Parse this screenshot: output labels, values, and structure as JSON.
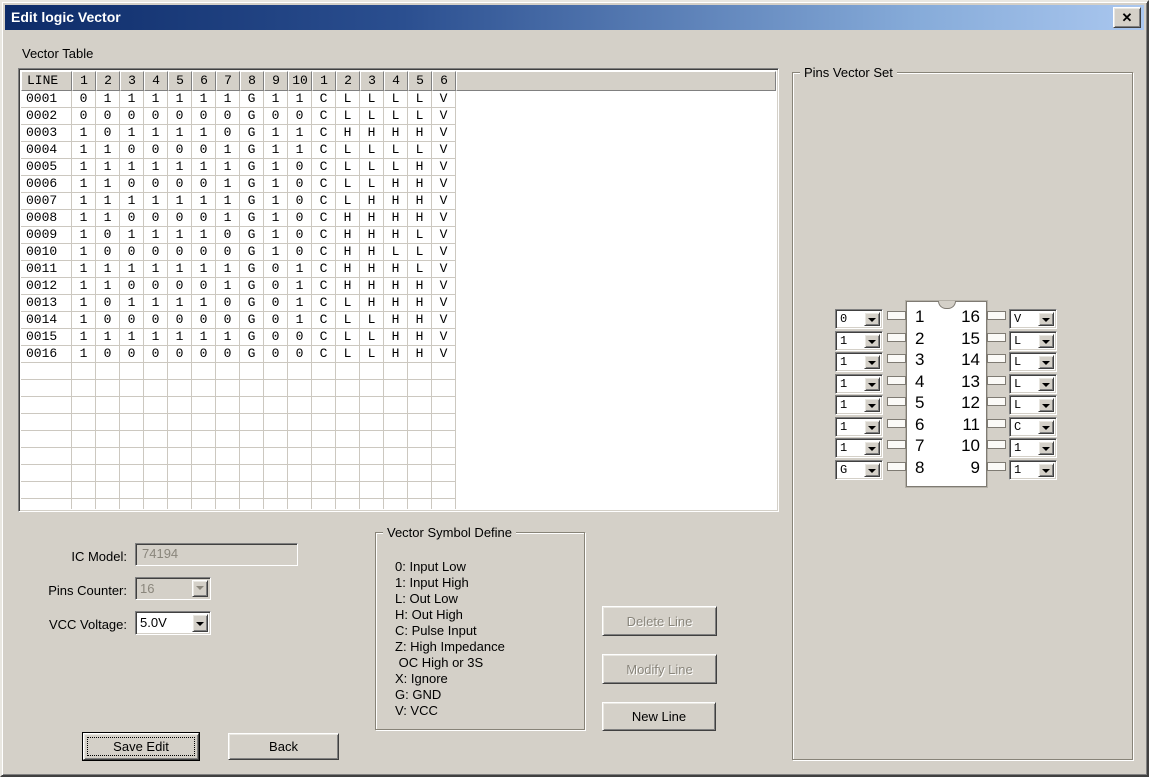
{
  "window": {
    "title": "Edit logic Vector",
    "close_icon": "✕"
  },
  "vector_table": {
    "label": "Vector Table",
    "line_header": "LINE",
    "columns": [
      "1",
      "2",
      "3",
      "4",
      "5",
      "6",
      "7",
      "8",
      "9",
      "10",
      "1",
      "2",
      "3",
      "4",
      "5",
      "6"
    ],
    "rows": [
      {
        "line": "0001",
        "cells": [
          "0",
          "1",
          "1",
          "1",
          "1",
          "1",
          "1",
          "G",
          "1",
          "1",
          "C",
          "L",
          "L",
          "L",
          "L",
          "V"
        ]
      },
      {
        "line": "0002",
        "cells": [
          "0",
          "0",
          "0",
          "0",
          "0",
          "0",
          "0",
          "G",
          "0",
          "0",
          "C",
          "L",
          "L",
          "L",
          "L",
          "V"
        ]
      },
      {
        "line": "0003",
        "cells": [
          "1",
          "0",
          "1",
          "1",
          "1",
          "1",
          "0",
          "G",
          "1",
          "1",
          "C",
          "H",
          "H",
          "H",
          "H",
          "V"
        ]
      },
      {
        "line": "0004",
        "cells": [
          "1",
          "1",
          "0",
          "0",
          "0",
          "0",
          "1",
          "G",
          "1",
          "1",
          "C",
          "L",
          "L",
          "L",
          "L",
          "V"
        ]
      },
      {
        "line": "0005",
        "cells": [
          "1",
          "1",
          "1",
          "1",
          "1",
          "1",
          "1",
          "G",
          "1",
          "0",
          "C",
          "L",
          "L",
          "L",
          "H",
          "V"
        ]
      },
      {
        "line": "0006",
        "cells": [
          "1",
          "1",
          "0",
          "0",
          "0",
          "0",
          "1",
          "G",
          "1",
          "0",
          "C",
          "L",
          "L",
          "H",
          "H",
          "V"
        ]
      },
      {
        "line": "0007",
        "cells": [
          "1",
          "1",
          "1",
          "1",
          "1",
          "1",
          "1",
          "G",
          "1",
          "0",
          "C",
          "L",
          "H",
          "H",
          "H",
          "V"
        ]
      },
      {
        "line": "0008",
        "cells": [
          "1",
          "1",
          "0",
          "0",
          "0",
          "0",
          "1",
          "G",
          "1",
          "0",
          "C",
          "H",
          "H",
          "H",
          "H",
          "V"
        ]
      },
      {
        "line": "0009",
        "cells": [
          "1",
          "0",
          "1",
          "1",
          "1",
          "1",
          "0",
          "G",
          "1",
          "0",
          "C",
          "H",
          "H",
          "H",
          "L",
          "V"
        ]
      },
      {
        "line": "0010",
        "cells": [
          "1",
          "0",
          "0",
          "0",
          "0",
          "0",
          "0",
          "G",
          "1",
          "0",
          "C",
          "H",
          "H",
          "L",
          "L",
          "V"
        ]
      },
      {
        "line": "0011",
        "cells": [
          "1",
          "1",
          "1",
          "1",
          "1",
          "1",
          "1",
          "G",
          "0",
          "1",
          "C",
          "H",
          "H",
          "H",
          "L",
          "V"
        ]
      },
      {
        "line": "0012",
        "cells": [
          "1",
          "1",
          "0",
          "0",
          "0",
          "0",
          "1",
          "G",
          "0",
          "1",
          "C",
          "H",
          "H",
          "H",
          "H",
          "V"
        ]
      },
      {
        "line": "0013",
        "cells": [
          "1",
          "0",
          "1",
          "1",
          "1",
          "1",
          "0",
          "G",
          "0",
          "1",
          "C",
          "L",
          "H",
          "H",
          "H",
          "V"
        ]
      },
      {
        "line": "0014",
        "cells": [
          "1",
          "0",
          "0",
          "0",
          "0",
          "0",
          "0",
          "G",
          "0",
          "1",
          "C",
          "L",
          "L",
          "H",
          "H",
          "V"
        ]
      },
      {
        "line": "0015",
        "cells": [
          "1",
          "1",
          "1",
          "1",
          "1",
          "1",
          "1",
          "G",
          "0",
          "0",
          "C",
          "L",
          "L",
          "H",
          "H",
          "V"
        ]
      },
      {
        "line": "0016",
        "cells": [
          "1",
          "0",
          "0",
          "0",
          "0",
          "0",
          "0",
          "G",
          "0",
          "0",
          "C",
          "L",
          "L",
          "H",
          "H",
          "V"
        ]
      }
    ]
  },
  "pins_vector_set": {
    "label": "Pins Vector Set",
    "left_pins": [
      {
        "pin": "1",
        "value": "0"
      },
      {
        "pin": "2",
        "value": "1"
      },
      {
        "pin": "3",
        "value": "1"
      },
      {
        "pin": "4",
        "value": "1"
      },
      {
        "pin": "5",
        "value": "1"
      },
      {
        "pin": "6",
        "value": "1"
      },
      {
        "pin": "7",
        "value": "1"
      },
      {
        "pin": "8",
        "value": "G"
      }
    ],
    "right_pins": [
      {
        "pin": "16",
        "value": "V"
      },
      {
        "pin": "15",
        "value": "L"
      },
      {
        "pin": "14",
        "value": "L"
      },
      {
        "pin": "13",
        "value": "L"
      },
      {
        "pin": "12",
        "value": "L"
      },
      {
        "pin": "11",
        "value": "C"
      },
      {
        "pin": "10",
        "value": "1"
      },
      {
        "pin": "9",
        "value": "1"
      }
    ]
  },
  "fields": {
    "ic_model_label": "IC Model:",
    "ic_model_value": "74194",
    "pins_counter_label": "Pins Counter:",
    "pins_counter_value": "16",
    "vcc_voltage_label": "VCC Voltage:",
    "vcc_voltage_value": "5.0V"
  },
  "symbol_define": {
    "label": "Vector Symbol Define",
    "lines": [
      "0: Input Low",
      "1: Input High",
      "L: Out Low",
      "H: Out High",
      "C: Pulse Input",
      "Z: High Impedance",
      " OC High or 3S",
      "X: Ignore",
      "G: GND",
      "V: VCC"
    ]
  },
  "buttons": {
    "delete_line": "Delete Line",
    "modify_line": "Modify Line",
    "new_line": "New Line",
    "save_edit": "Save Edit",
    "back": "Back"
  }
}
